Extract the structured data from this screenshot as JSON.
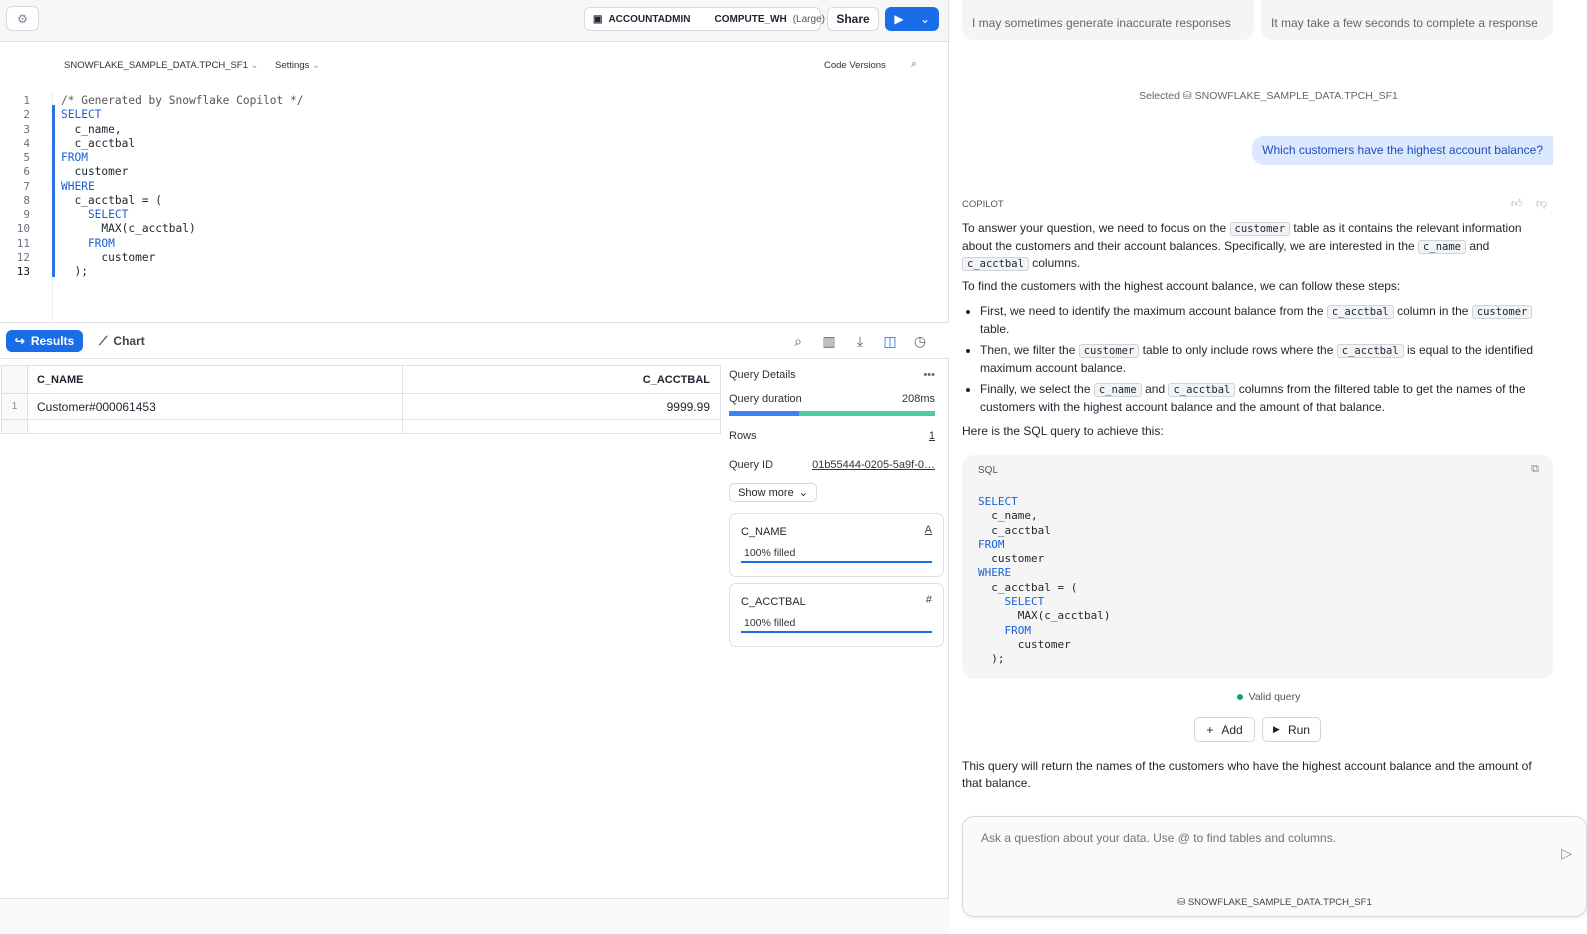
{
  "topbar": {
    "role": "ACCOUNTADMIN",
    "warehouse": "COMPUTE_WH",
    "size": "(Large)",
    "share": "Share"
  },
  "editor": {
    "database": "SNOWFLAKE_SAMPLE_DATA.TPCH_SF1",
    "settings": "Settings",
    "code_versions": "Code Versions",
    "lines": [
      "/* Generated by Snowflake Copilot */",
      "SELECT",
      "  c_name,",
      "  c_acctbal",
      "FROM",
      "  customer",
      "WHERE",
      "  c_acctbal = (",
      "    SELECT",
      "      MAX(c_acctbal)",
      "    FROM",
      "      customer",
      "  );"
    ]
  },
  "results": {
    "tab_results": "Results",
    "tab_chart": "Chart",
    "columns": [
      "C_NAME",
      "C_ACCTBAL"
    ],
    "rows": [
      {
        "n": "1",
        "c_name": "Customer#000061453",
        "c_acctbal": "9999.99"
      }
    ]
  },
  "details": {
    "title": "Query Details",
    "duration_label": "Query duration",
    "duration": "208ms",
    "duration_split": 0.34,
    "rows_label": "Rows",
    "rows": "1",
    "qid_label": "Query ID",
    "qid": "01b55444-0205-5a9f-0…",
    "show_more": "Show more",
    "cols": [
      {
        "name": "C_NAME",
        "type": "A",
        "filled": "100% filled",
        "fill": 1.0
      },
      {
        "name": "C_ACCTBAL",
        "type": "#",
        "filled": "100% filled",
        "fill": 1.0
      }
    ]
  },
  "copilot": {
    "notes": [
      "I may sometimes generate inaccurate responses",
      "It may take a few seconds to complete a response"
    ],
    "selected_label": "Selected",
    "selected_db": "SNOWFLAKE_SAMPLE_DATA.TPCH_SF1",
    "question": "Which customers have the highest account balance?",
    "label": "COPILOT",
    "p1": [
      "To answer your question, we need to focus on the ",
      "customer",
      " table as it contains the relevant information about the customers and their account balances. Specifically, we are interested in the ",
      "c_name",
      " and ",
      "c_acctbal",
      " columns."
    ],
    "p2": "To find the customers with the highest account balance, we can follow these steps:",
    "b1": [
      "First, we need to identify the maximum account balance from the ",
      "c_acctbal",
      " column in the ",
      "customer",
      " table."
    ],
    "b2": [
      "Then, we filter the ",
      "customer",
      " table to only include rows where the ",
      "c_acctbal",
      " is equal to the identified maximum account balance."
    ],
    "b3": [
      "Finally, we select the ",
      "c_name",
      " and ",
      "c_acctbal",
      " columns from the filtered table to get the names of the customers with the highest account balance and the amount of that balance."
    ],
    "p3": "Here is the SQL query to achieve this:",
    "sql_label": "SQL",
    "sql": "SELECT\n  c_name,\n  c_acctbal\nFROM\n  customer\nWHERE\n  c_acctbal = (\n    SELECT\n      MAX(c_acctbal)\n    FROM\n      customer\n  );",
    "valid": "Valid query",
    "add": "Add",
    "run": "Run",
    "p4": "This query will return the names of the customers who have the highest account balance and the amount of that balance.",
    "placeholder": "Ask a question about your data. Use @ to find tables and columns.",
    "composer_db": "SNOWFLAKE_SAMPLE_DATA.TPCH_SF1"
  },
  "colors": {
    "accent": "#1a6ce7",
    "duration_a": "#3b82f6",
    "duration_b": "#4fcaa0",
    "valid": "#16a36b"
  }
}
